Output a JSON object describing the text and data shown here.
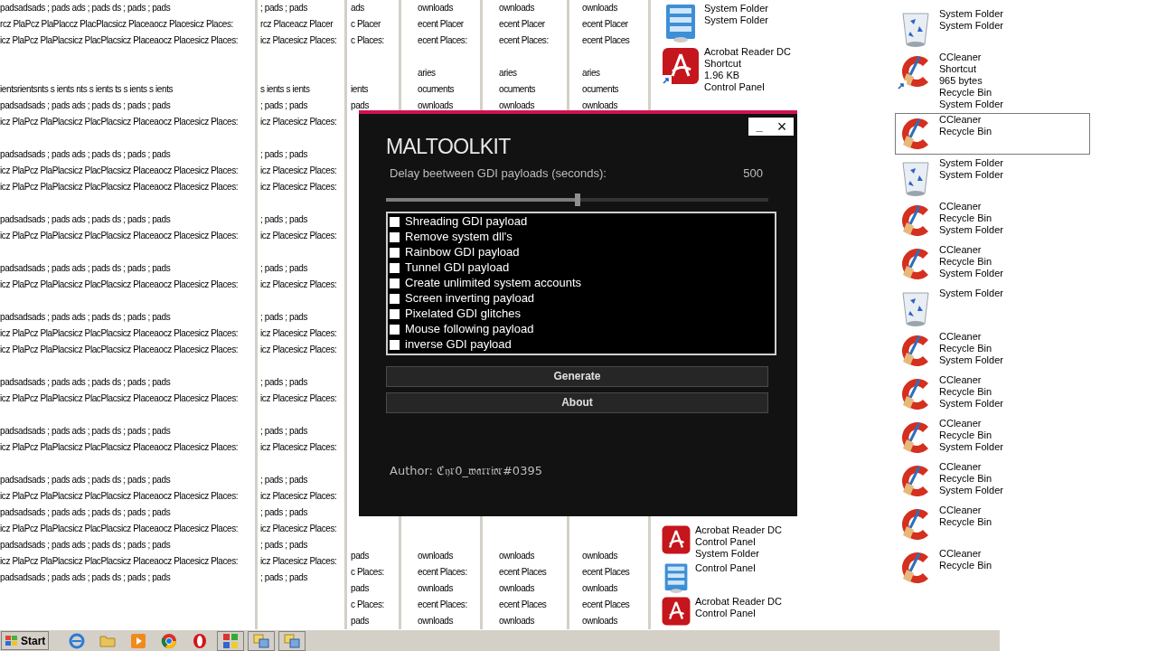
{
  "desktop": {
    "text_columns": [
      {
        "top": [
          {
            "kind": "text",
            "text": "padsadsads ; pads ads ; pads ds ; pads ; pads"
          },
          {
            "kind": "text",
            "text": "rcz PlaPcz PlaPlaccz PlacPlacsicz Placeaocz Placesicz Places:"
          },
          {
            "kind": "text",
            "text": "icz PlaPcz PlaPlacsicz PlacPlacsicz Placeaocz Placesicz Places:"
          },
          {
            "kind": "gap"
          },
          {
            "kind": "gap"
          },
          {
            "kind": "text",
            "text": "ientsrientsnts s ients nts s ients ts s ients s ients"
          },
          {
            "kind": "text",
            "text": "padsadsads ; pads ads ; pads ds ; pads ; pads"
          },
          {
            "kind": "text",
            "text": "icz PlaPcz PlaPlacsicz PlacPlacsicz Placeaocz Placesicz Places:"
          },
          {
            "kind": "gap"
          },
          {
            "kind": "text",
            "text": "padsadsads ; pads ads ; pads ds ; pads ; pads"
          },
          {
            "kind": "text",
            "text": "icz PlaPcz PlaPlacsicz PlacPlacsicz Placeaocz Placesicz Places:"
          },
          {
            "kind": "text",
            "text": "icz PlaPcz PlaPlacsicz PlacPlacsicz Placeaocz Placesicz Places:"
          },
          {
            "kind": "gap"
          },
          {
            "kind": "text",
            "text": "padsadsads ; pads ads ; pads ds ; pads ; pads"
          },
          {
            "kind": "text",
            "text": "icz PlaPcz PlaPlacsicz PlacPlacsicz Placeaocz Placesicz Places:"
          },
          {
            "kind": "gap"
          },
          {
            "kind": "text",
            "text": "padsadsads ; pads ads ; pads ds ; pads ; pads"
          },
          {
            "kind": "text",
            "text": "icz PlaPcz PlaPlacsicz PlacPlacsicz Placeaocz Placesicz Places:"
          },
          {
            "kind": "gap"
          },
          {
            "kind": "text",
            "text": "padsadsads ; pads ads ; pads ds ; pads ; pads"
          },
          {
            "kind": "text",
            "text": "icz PlaPcz PlaPlacsicz PlacPlacsicz Placeaocz Placesicz Places:"
          },
          {
            "kind": "text",
            "text": "icz PlaPcz PlaPlacsicz PlacPlacsicz Placeaocz Placesicz Places:"
          },
          {
            "kind": "gap"
          },
          {
            "kind": "text",
            "text": "padsadsads ; pads ads ; pads ds ; pads ; pads"
          },
          {
            "kind": "text",
            "text": "icz PlaPcz PlaPlacsicz PlacPlacsicz Placeaocz Placesicz Places:"
          },
          {
            "kind": "gap"
          },
          {
            "kind": "text",
            "text": "padsadsads ; pads ads ; pads ds ; pads ; pads"
          },
          {
            "kind": "text",
            "text": "icz PlaPcz PlaPlacsicz PlacPlacsicz Placeaocz Placesicz Places:"
          },
          {
            "kind": "gap"
          },
          {
            "kind": "text",
            "text": "padsadsads ; pads ads ; pads ds ; pads ; pads"
          },
          {
            "kind": "text",
            "text": "icz PlaPcz PlaPlacsicz PlacPlacsicz Placeaocz Placesicz Places:"
          },
          {
            "kind": "text",
            "text": "padsadsads ; pads ads ; pads ds ; pads ; pads"
          },
          {
            "kind": "text",
            "text": "icz PlaPcz PlaPlacsicz PlacPlacsicz Placeaocz Placesicz Places:"
          },
          {
            "kind": "text",
            "text": "padsadsads ; pads ads ; pads ds ; pads ; pads"
          },
          {
            "kind": "text",
            "text": "icz PlaPcz PlaPlacsicz PlacPlacsicz Placeaocz Placesicz Places:"
          },
          {
            "kind": "text",
            "text": "padsadsads ; pads ads ; pads ds ; pads ; pads"
          }
        ]
      },
      {
        "top": [
          {
            "kind": "text",
            "text": "; pads ; pads"
          },
          {
            "kind": "text",
            "text": "rcz Placeacz Placer"
          },
          {
            "kind": "text",
            "text": "icz Placesicz Places:"
          },
          {
            "kind": "gap"
          },
          {
            "kind": "gap"
          },
          {
            "kind": "text",
            "text": "s ients s ients"
          },
          {
            "kind": "text",
            "text": "; pads ; pads"
          },
          {
            "kind": "text",
            "text": "icz Placesicz Places:"
          },
          {
            "kind": "gap"
          },
          {
            "kind": "text",
            "text": "; pads ; pads"
          },
          {
            "kind": "text",
            "text": "icz Placesicz Places:"
          },
          {
            "kind": "text",
            "text": "icz Placesicz Places:"
          },
          {
            "kind": "gap"
          },
          {
            "kind": "text",
            "text": "; pads ; pads"
          },
          {
            "kind": "text",
            "text": "icz Placesicz Places:"
          },
          {
            "kind": "gap"
          },
          {
            "kind": "text",
            "text": "; pads ; pads"
          },
          {
            "kind": "text",
            "text": "icz Placesicz Places:"
          },
          {
            "kind": "gap"
          },
          {
            "kind": "text",
            "text": "; pads ; pads"
          },
          {
            "kind": "text",
            "text": "icz Placesicz Places:"
          },
          {
            "kind": "text",
            "text": "icz Placesicz Places:"
          },
          {
            "kind": "gap"
          },
          {
            "kind": "text",
            "text": "; pads ; pads"
          },
          {
            "kind": "text",
            "text": "icz Placesicz Places:"
          },
          {
            "kind": "gap"
          },
          {
            "kind": "text",
            "text": "; pads ; pads"
          },
          {
            "kind": "text",
            "text": "icz Placesicz Places:"
          },
          {
            "kind": "gap"
          },
          {
            "kind": "text",
            "text": "; pads ; pads"
          },
          {
            "kind": "text",
            "text": "icz Placesicz Places:"
          },
          {
            "kind": "text",
            "text": "; pads ; pads"
          },
          {
            "kind": "text",
            "text": "icz Placesicz Places:"
          },
          {
            "kind": "text",
            "text": "; pads ; pads"
          },
          {
            "kind": "text",
            "text": "icz Placesicz Places:"
          },
          {
            "kind": "text",
            "text": "; pads ; pads"
          }
        ]
      },
      {
        "top": [
          {
            "kind": "text",
            "text": "ads"
          },
          {
            "kind": "text",
            "text": "c Placer"
          },
          {
            "kind": "text",
            "text": "c Places:"
          },
          {
            "kind": "gap"
          },
          {
            "kind": "gap"
          },
          {
            "kind": "text",
            "text": "ients"
          },
          {
            "kind": "text",
            "text": "pads"
          }
        ],
        "bottom": [
          {
            "kind": "text",
            "text": "pads"
          },
          {
            "kind": "text",
            "text": "c Places:"
          },
          {
            "kind": "text",
            "text": "pads"
          },
          {
            "kind": "text",
            "text": "c Places:"
          },
          {
            "kind": "text",
            "text": "pads"
          }
        ]
      },
      {
        "top": [
          {
            "kind": "text",
            "text": "ownloads"
          },
          {
            "kind": "text",
            "text": "ecent Placer"
          },
          {
            "kind": "text",
            "text": "ecent Places:"
          },
          {
            "kind": "gap"
          },
          {
            "kind": "text",
            "text": "aries"
          },
          {
            "kind": "text",
            "text": "ocuments"
          },
          {
            "kind": "text",
            "text": "ownloads"
          }
        ],
        "bottom": [
          {
            "kind": "text",
            "text": "ownloads"
          },
          {
            "kind": "text",
            "text": "ecent Places:"
          },
          {
            "kind": "text",
            "text": "ownloads"
          },
          {
            "kind": "text",
            "text": "ecent Places:"
          },
          {
            "kind": "text",
            "text": "ownloads"
          }
        ]
      },
      {
        "top": [
          {
            "kind": "text",
            "text": "ownloads"
          },
          {
            "kind": "text",
            "text": "ecent Placer"
          },
          {
            "kind": "text",
            "text": "ecent Places:"
          },
          {
            "kind": "gap"
          },
          {
            "kind": "text",
            "text": "aries"
          },
          {
            "kind": "text",
            "text": "ocuments"
          },
          {
            "kind": "text",
            "text": "ownloads"
          }
        ],
        "bottom": [
          {
            "kind": "text",
            "text": "ownloads"
          },
          {
            "kind": "text",
            "text": "ecent Places"
          },
          {
            "kind": "text",
            "text": "ownloads"
          },
          {
            "kind": "text",
            "text": "ecent Places"
          },
          {
            "kind": "text",
            "text": "ownloads"
          }
        ]
      },
      {
        "top": [
          {
            "kind": "text",
            "text": "ownloads"
          },
          {
            "kind": "text",
            "text": "ecent Placer"
          },
          {
            "kind": "text",
            "text": "ecent Places"
          },
          {
            "kind": "gap"
          },
          {
            "kind": "text",
            "text": "aries"
          },
          {
            "kind": "text",
            "text": "ocuments"
          },
          {
            "kind": "text",
            "text": "ownloads"
          }
        ],
        "bottom": [
          {
            "kind": "text",
            "text": "ownloads"
          },
          {
            "kind": "text",
            "text": "ecent Places"
          },
          {
            "kind": "text",
            "text": "ownloads"
          },
          {
            "kind": "text",
            "text": "ecent Places"
          },
          {
            "kind": "text",
            "text": "ownloads"
          }
        ]
      }
    ],
    "icon_columns": [
      {
        "top": [
          {
            "kind": "control_panel",
            "shortcut": false,
            "selected": false,
            "lines": [
              "System Folder",
              "System Folder"
            ]
          },
          {
            "kind": "acrobat",
            "shortcut": true,
            "selected": false,
            "lines": [
              "Acrobat Reader DC",
              "Shortcut",
              "1.96 KB",
              "Control Panel"
            ]
          }
        ],
        "bottom": [
          {
            "kind": "acrobat",
            "shortcut": false,
            "selected": false,
            "lines": [
              "Acrobat Reader DC",
              "Control Panel",
              "System Folder"
            ]
          },
          {
            "kind": "control_panel",
            "shortcut": false,
            "selected": false,
            "lines": [
              "Control Panel"
            ]
          },
          {
            "kind": "acrobat",
            "shortcut": false,
            "selected": false,
            "lines": [
              "Acrobat Reader DC",
              "Control Panel"
            ]
          }
        ]
      },
      {
        "top": [
          {
            "kind": "recycle_bin",
            "shortcut": false,
            "selected": false,
            "lines": [
              "System Folder",
              "System Folder"
            ]
          },
          {
            "kind": "ccleaner",
            "shortcut": true,
            "selected": false,
            "lines": [
              "CCleaner",
              "Shortcut",
              "965 bytes",
              "Recycle Bin",
              "System Folder"
            ]
          },
          {
            "kind": "ccleaner",
            "shortcut": false,
            "selected": true,
            "lines": [
              "CCleaner",
              "Recycle Bin"
            ]
          },
          {
            "kind": "recycle_bin",
            "shortcut": false,
            "selected": false,
            "lines": [
              "System Folder",
              "System Folder"
            ]
          },
          {
            "kind": "ccleaner",
            "shortcut": false,
            "selected": false,
            "lines": [
              "CCleaner",
              "Recycle Bin",
              "System Folder"
            ]
          },
          {
            "kind": "ccleaner",
            "shortcut": false,
            "selected": false,
            "lines": [
              "CCleaner",
              "Recycle Bin",
              "System Folder"
            ]
          },
          {
            "kind": "recycle_bin",
            "shortcut": false,
            "selected": false,
            "lines": [
              "System Folder"
            ]
          },
          {
            "kind": "ccleaner",
            "shortcut": false,
            "selected": false,
            "lines": [
              "CCleaner",
              "Recycle Bin",
              "System Folder"
            ]
          },
          {
            "kind": "ccleaner",
            "shortcut": false,
            "selected": false,
            "lines": [
              "CCleaner",
              "Recycle Bin",
              "System Folder"
            ]
          },
          {
            "kind": "ccleaner",
            "shortcut": false,
            "selected": false,
            "lines": [
              "CCleaner",
              "Recycle Bin",
              "System Folder"
            ]
          },
          {
            "kind": "ccleaner",
            "shortcut": false,
            "selected": false,
            "lines": [
              "CCleaner",
              "Recycle Bin",
              "System Folder"
            ]
          },
          {
            "kind": "ccleaner",
            "shortcut": false,
            "selected": false,
            "lines": [
              "CCleaner",
              "Recycle Bin"
            ]
          },
          {
            "kind": "ccleaner",
            "shortcut": false,
            "selected": false,
            "lines": [
              "CCleaner",
              "Recycle Bin"
            ]
          }
        ]
      }
    ]
  },
  "window": {
    "title": "MALTOOLKIT",
    "minimize": "_",
    "close": "×",
    "delay": {
      "label": "Delay beetween GDI payloads (seconds):",
      "reading": "500",
      "level": 0.5
    },
    "payloads": [
      {
        "label": "Shreading GDI payload",
        "checked": false
      },
      {
        "label": "Remove system dll's",
        "checked": false
      },
      {
        "label": "Rainbow GDI payload",
        "checked": false
      },
      {
        "label": "Tunnel GDI payload",
        "checked": false
      },
      {
        "label": "Create unlimited system accounts",
        "checked": false
      },
      {
        "label": "Screen inverting payload",
        "checked": false
      },
      {
        "label": "Pixelated GDI glitches",
        "checked": false
      },
      {
        "label": "Mouse following payload",
        "checked": false
      },
      {
        "label": "inverse GDI payload",
        "checked": false
      }
    ],
    "buttons": [
      "Generate",
      "About"
    ],
    "author": "Author: ℭ𝔶𝔯0_𝔴𝔞𝔯𝔯𝔦𝔬𝔯#0395"
  },
  "taskbar": {
    "start": "Start",
    "apps": [
      {
        "kind": "ie"
      },
      {
        "kind": "folder"
      },
      {
        "kind": "media"
      },
      {
        "kind": "chrome"
      },
      {
        "kind": "opera"
      },
      {
        "kind": "grid"
      },
      {
        "kind": "window"
      },
      {
        "kind": "window"
      }
    ]
  }
}
